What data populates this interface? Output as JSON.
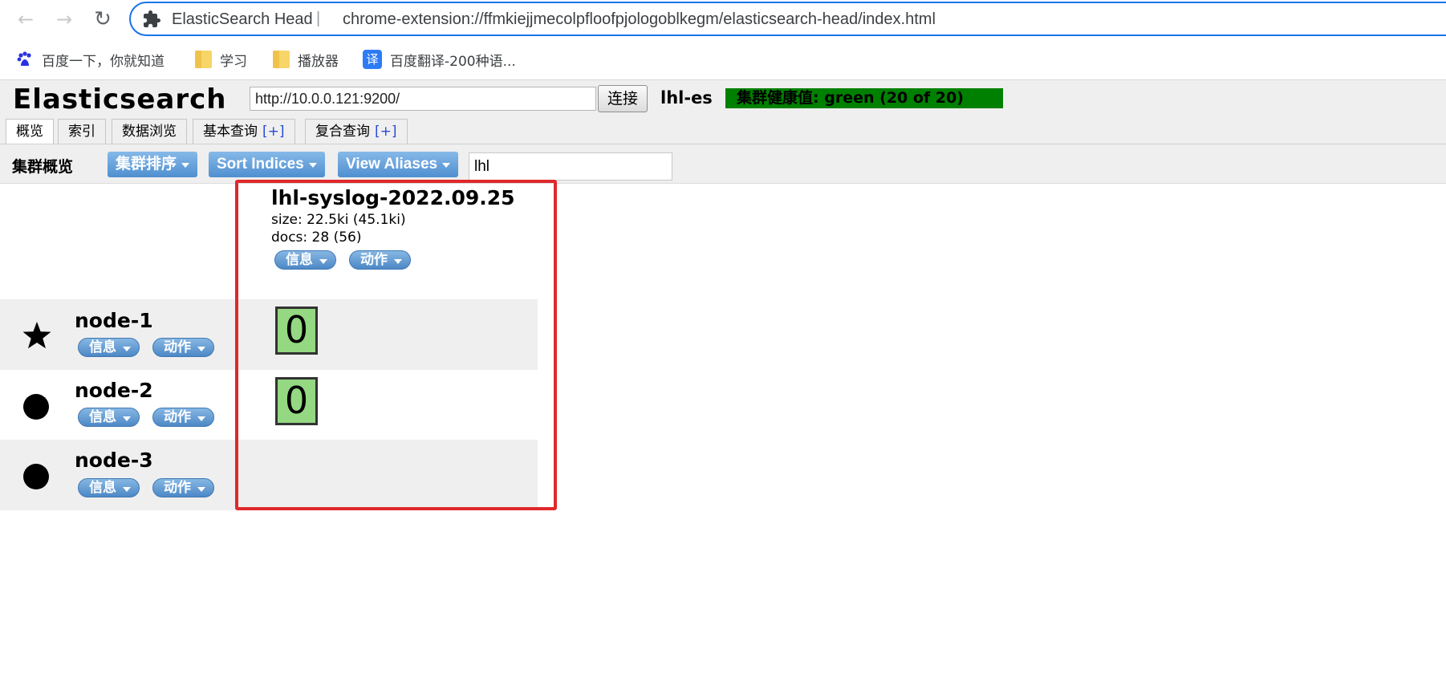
{
  "browser": {
    "site_name": "ElasticSearch Head",
    "url": "chrome-extension://ffmkiejjmecolpfloofpjologoblkegm/elasticsearch-head/index.html",
    "bookmarks": [
      {
        "label": "百度一下，你就知道",
        "icon": "baidu-paw-icon"
      },
      {
        "label": "学习",
        "icon": "folder-icon"
      },
      {
        "label": "播放器",
        "icon": "folder-icon"
      },
      {
        "label": "百度翻译-200种语...",
        "icon": "baidu-translate-icon",
        "icon_glyph": "译"
      }
    ]
  },
  "header": {
    "title": "Elasticsearch",
    "connect_url": "http://10.0.0.121:9200/",
    "connect_label": "连接",
    "cluster_name": "lhl-es",
    "health": "集群健康值: green (20 of 20)",
    "health_color": "#008000"
  },
  "tabs": [
    {
      "label": "概览",
      "plus": ""
    },
    {
      "label": "索引",
      "plus": ""
    },
    {
      "label": "数据浏览",
      "plus": ""
    },
    {
      "label": "基本查询",
      "plus": "[+]"
    },
    {
      "label": "复合查询",
      "plus": "[+]"
    }
  ],
  "toolbar": {
    "label": "集群概览",
    "buttons": [
      "集群排序",
      "Sort Indices",
      "View Aliases"
    ],
    "filter_value": "lhl"
  },
  "index": {
    "name": "lhl-syslog-2022.09.25",
    "size": "size: 22.5ki (45.1ki)",
    "docs": "docs: 28 (56)",
    "info_label": "信息",
    "action_label": "动作"
  },
  "nodes": [
    {
      "name": "node-1",
      "icon": "star-icon",
      "info_label": "信息",
      "action_label": "动作",
      "shard": "0"
    },
    {
      "name": "node-2",
      "icon": "circle-icon",
      "info_label": "信息",
      "action_label": "动作",
      "shard": "0"
    },
    {
      "name": "node-3",
      "icon": "circle-icon",
      "info_label": "信息",
      "action_label": "动作",
      "shard": ""
    }
  ],
  "colors": {
    "shard_fill": "#94d882",
    "highlight_border": "#e0282b",
    "button_blue": "#4f8fd0"
  }
}
